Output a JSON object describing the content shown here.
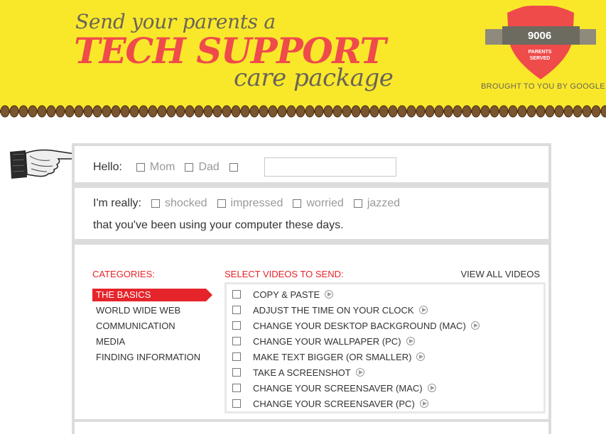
{
  "header": {
    "tagline_line1": "Send your parents a",
    "tagline_line2": "TECH SUPPORT",
    "tagline_line3": "care package",
    "counter": "9006",
    "counter_label_line1": "PARENTS",
    "counter_label_line2": "SERVED",
    "brought_by": "BROUGHT TO YOU BY GOOGLE"
  },
  "hello": {
    "label": "Hello:",
    "options": [
      "Mom",
      "Dad"
    ],
    "custom_name_value": ""
  },
  "mood": {
    "label": "I'm really:",
    "options": [
      "shocked",
      "impressed",
      "worried",
      "jazzed"
    ],
    "line2": "that you've been using your computer these days."
  },
  "categories": {
    "title": "CATEGORIES:",
    "items": [
      "THE BASICS",
      "WORLD WIDE WEB",
      "COMMUNICATION",
      "MEDIA",
      "FINDING INFORMATION"
    ],
    "active": "THE BASICS"
  },
  "videos": {
    "title": "SELECT VIDEOS TO SEND:",
    "view_all": "VIEW ALL VIDEOS",
    "items": [
      "COPY & PASTE",
      "ADJUST THE TIME ON YOUR CLOCK",
      "CHANGE YOUR DESKTOP BACKGROUND (MAC)",
      "CHANGE YOUR WALLPAPER (PC)",
      "MAKE TEXT BIGGER (OR SMALLER)",
      "TAKE A SCREENSHOT",
      "CHANGE YOUR SCREENSAVER (MAC)",
      "CHANGE YOUR SCREENSAVER (PC)"
    ]
  },
  "colors": {
    "header_yellow": "#f9e82a",
    "accent_red": "#e6242b",
    "brown_rope": "#6b4a2a"
  },
  "icons": [
    "shield-badge-icon",
    "pointing-hand-icon",
    "play-icon",
    "checkbox-icon"
  ]
}
